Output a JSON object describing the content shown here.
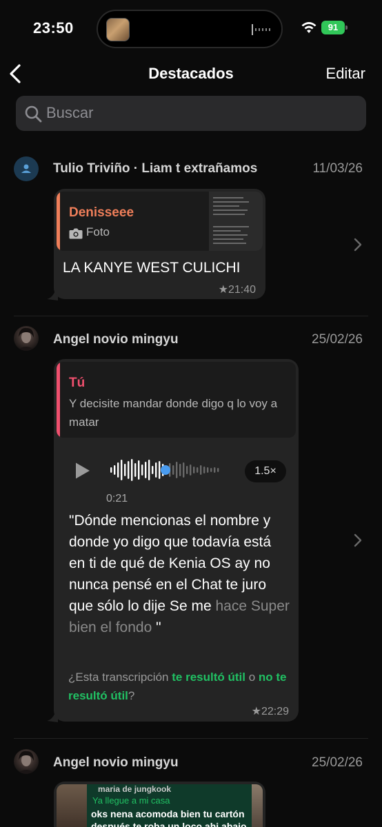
{
  "status_bar": {
    "time": "23:50",
    "battery": "91"
  },
  "nav": {
    "title": "Destacados",
    "edit_label": "Editar"
  },
  "search": {
    "placeholder": "Buscar"
  },
  "items": [
    {
      "sender": "Tulio Triviño · Liam t extrañamos",
      "date": "11/03/26",
      "quote_name": "Denisseee",
      "quote_kind": "Foto",
      "text": "LA KANYE WEST CULICHI",
      "time": "★21:40",
      "quote_color": "#f07f5a"
    },
    {
      "sender": "Angel novio mingyu",
      "date": "25/02/26",
      "quote_name": "Tú",
      "quote_text": "Y decisite mandar donde digo q lo voy a matar",
      "voice_speed": "1.5×",
      "voice_duration": "0:21",
      "voice_progress": 0.5,
      "transcript_main": "\"Dónde mencionas el nombre y donde yo digo que todavía está en ti de qué de Kenia OS ay no nunca pensé en el Chat te juro que sólo lo dije Se me",
      "transcript_dim": "hace Super bien el fondo",
      "transcript_end": " \"",
      "feedback_q": "¿Esta transcripción",
      "feedback_yes": "te resultó útil",
      "feedback_or": "o",
      "feedback_no": "no te resultó útil",
      "feedback_mark": "?",
      "time": "★22:29",
      "quote_color": "#f0506e"
    },
    {
      "sender": "Angel novio mingyu",
      "date": "25/02/26",
      "preview_name": "maria de jungkook",
      "preview_sub": "Ya llegue a mi casa",
      "preview_text": "oks nena acomoda bien tu cartón después te roba un loco ahi abajo del"
    }
  ],
  "colors": {
    "accent_green": "#21c063",
    "bubble": "#242424",
    "background": "#0b0b0b"
  }
}
